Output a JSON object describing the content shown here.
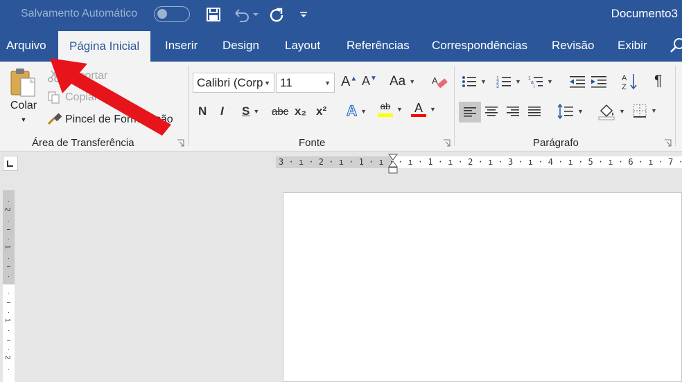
{
  "title_bar": {
    "autosave_label": "Salvamento Automático",
    "document_title": "Documento3"
  },
  "tabs": [
    {
      "label": "Arquivo"
    },
    {
      "label": "Página Inicial",
      "active": true
    },
    {
      "label": "Inserir"
    },
    {
      "label": "Design"
    },
    {
      "label": "Layout"
    },
    {
      "label": "Referências"
    },
    {
      "label": "Correspondências"
    },
    {
      "label": "Revisão"
    },
    {
      "label": "Exibir"
    }
  ],
  "clipboard": {
    "paste_label": "Colar",
    "cut_label": "Recortar",
    "copy_label": "Copiar",
    "format_painter_label": "Pincel de Formatação",
    "group_label": "Área de Transferência"
  },
  "font": {
    "font_name": "Calibri (Corp",
    "font_size": "11",
    "change_case_label": "Aa",
    "bold": "N",
    "italic": "I",
    "underline": "S",
    "strikethrough": "abc",
    "subscript": "x₂",
    "superscript": "x²",
    "text_effects": "A",
    "highlight": "ab",
    "font_color": "A",
    "group_label": "Fonte"
  },
  "paragraph": {
    "show_marks": "¶",
    "group_label": "Parágrafo"
  },
  "ruler": {
    "horizontal_left": "3 · ı · 2 · ı · 1 · ı ·",
    "horizontal_right": "· ı · 1 · ı · 2 · ı · 3 · ı · 4 · ı · 5 · ı · 6 · ı · 7 · ı"
  },
  "annotation": {
    "arrow_color": "#e8141c"
  },
  "colors": {
    "accent": "#2b579a",
    "ribbon_bg": "#f3f3f3",
    "highlight_yellow": "#ffff00",
    "font_red": "#ff0000"
  }
}
